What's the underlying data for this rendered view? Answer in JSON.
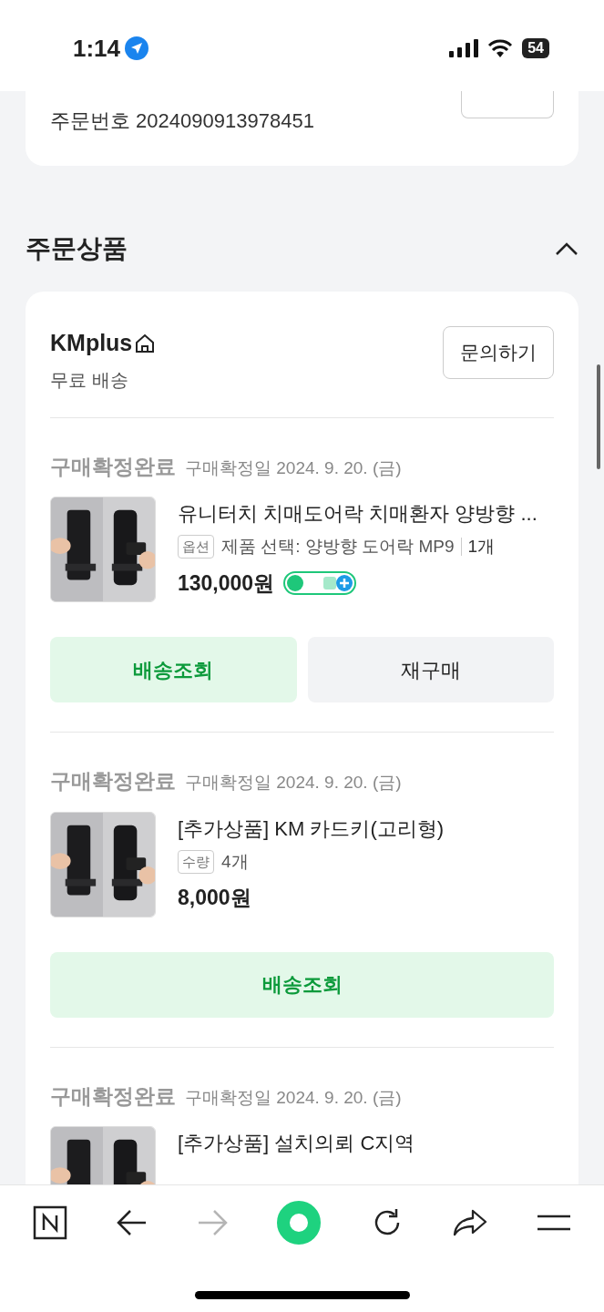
{
  "status_bar": {
    "time": "1:14",
    "battery": "54"
  },
  "order_card": {
    "order_number": "주문번호 2024090913978451"
  },
  "section": {
    "title": "주문상품",
    "expanded": true
  },
  "seller": {
    "name": "KMplus",
    "shipping": "무료 배송",
    "inquiry_button": "문의하기"
  },
  "items": [
    {
      "status": "구매확정완료",
      "date": "구매확정일 2024. 9. 20. (금)",
      "title": "유니터치 치매도어락 치매환자 양방향 ...",
      "option_tag": "옵션",
      "option": "제품 선택: 양방향 도어락 MP9",
      "quantity": "1개",
      "price": "130,000원",
      "npay": true,
      "buttons": [
        {
          "label": "배송조회",
          "kind": "primary"
        },
        {
          "label": "재구매",
          "kind": "secondary"
        }
      ]
    },
    {
      "status": "구매확정완료",
      "date": "구매확정일 2024. 9. 20. (금)",
      "title": "[추가상품] KM 카드키(고리형)",
      "option_tag": "수량",
      "option": "4개",
      "price": "8,000원",
      "npay": false,
      "buttons": [
        {
          "label": "배송조회",
          "kind": "primary"
        }
      ]
    },
    {
      "status": "구매확정완료",
      "date": "구매확정일 2024. 9. 20. (금)",
      "title": "[추가상품] 설치의뢰 C지역",
      "npay": false
    }
  ],
  "browser_nav": [
    {
      "kind": "home",
      "disabled": false
    },
    {
      "kind": "back",
      "disabled": false
    },
    {
      "kind": "forward",
      "disabled": true
    },
    {
      "kind": "green",
      "disabled": false
    },
    {
      "kind": "reload",
      "disabled": false
    },
    {
      "kind": "share",
      "disabled": false
    },
    {
      "kind": "menu",
      "disabled": false
    }
  ]
}
